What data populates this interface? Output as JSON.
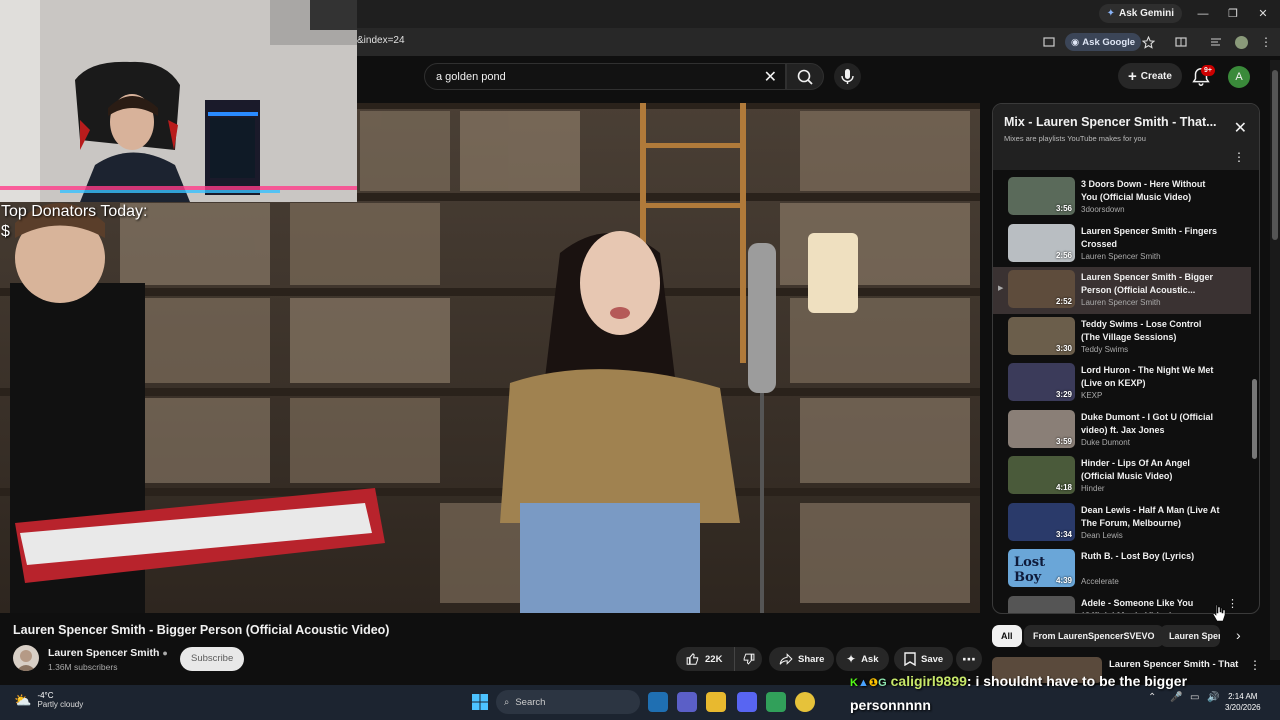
{
  "browser": {
    "gemini_label": "Ask Gemini",
    "url_fragment": "&index=24",
    "ask_google_label": "Ask Google"
  },
  "youtube": {
    "search_value": "a golden pond",
    "create_label": "Create",
    "notif_badge": "9+",
    "avatar_letter": "A"
  },
  "video": {
    "title": "Lauren Spencer Smith - Bigger Person (Official Acoustic Video)",
    "channel": "Lauren Spencer Smith",
    "subscribers": "1.36M subscribers",
    "subscribe_label": "Subscribe",
    "likes": "22K",
    "share_label": "Share",
    "ask_label": "Ask",
    "save_label": "Save"
  },
  "stream": {
    "donators_label": "Top Donators Today:",
    "donators_value": "$"
  },
  "playlist": {
    "title": "Mix - Lauren Spencer Smith - That...",
    "subtitle": "Mixes are playlists YouTube makes for you",
    "items": [
      {
        "title": "3 Doors Down - Here Without You (Official Music Video)",
        "channel": "3doorsdown",
        "duration": "3:56",
        "color": "#5a6a5a"
      },
      {
        "title": "Lauren Spencer Smith - Fingers Crossed",
        "channel": "Lauren Spencer Smith",
        "duration": "2:56",
        "color": "#b9bec2"
      },
      {
        "title": "Lauren Spencer Smith - Bigger Person (Official Acoustic...",
        "channel": "Lauren Spencer Smith",
        "duration": "2:52",
        "color": "#5e4c3c",
        "active": true
      },
      {
        "title": "Teddy Swims - Lose Control (The Village Sessions)",
        "channel": "Teddy Swims",
        "duration": "3:30",
        "color": "#6b5e4b"
      },
      {
        "title": "Lord Huron - The Night We Met (Live on KEXP)",
        "channel": "KEXP",
        "duration": "3:29",
        "color": "#3b3b5a"
      },
      {
        "title": "Duke Dumont - I Got U (Official video) ft. Jax Jones",
        "channel": "Duke Dumont",
        "duration": "3:59",
        "color": "#8a7f77"
      },
      {
        "title": "Hinder - Lips Of An Angel (Official Music Video)",
        "channel": "Hinder",
        "duration": "4:18",
        "color": "#4a5a3a"
      },
      {
        "title": "Dean Lewis - Half A Man (Live At The Forum, Melbourne)",
        "channel": "Dean Lewis",
        "duration": "3:34",
        "color": "#2a3a6a"
      },
      {
        "title": "Ruth B. - Lost Boy (Lyrics)",
        "channel": "Accelerate",
        "duration": "4:39",
        "color": "#6aa6d8",
        "thumb_text": "Lost Boy"
      },
      {
        "title": "Adele - Someone Like You (Official Music Video)",
        "channel": "",
        "duration": "",
        "color": "#555"
      }
    ]
  },
  "chips": [
    "All",
    "From LaurenSpencerSVEVO",
    "Lauren Spenc"
  ],
  "next_rec_title": "Lauren Spencer Smith - That",
  "chat": {
    "user": "caligirl9899",
    "message": ": i shouldnt have to be the bigger personnnnn"
  },
  "taskbar": {
    "temp": "-4°C",
    "weather": "Partly cloudy",
    "search_label": "Search",
    "time": "2:14 AM",
    "date": "3/20/2026"
  }
}
